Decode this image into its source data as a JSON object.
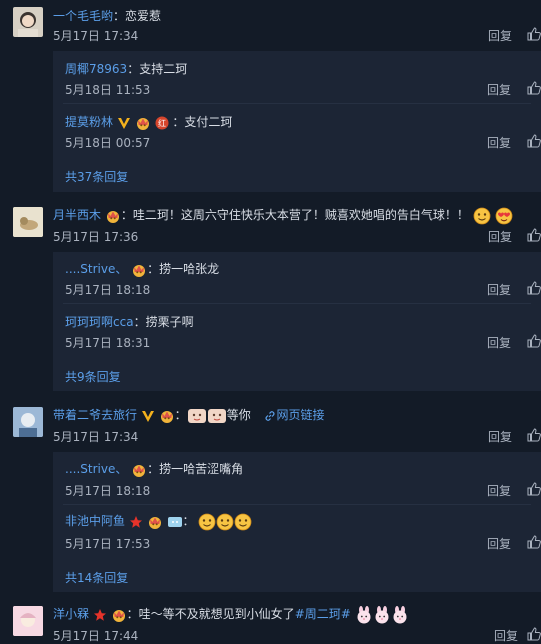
{
  "comments": [
    {
      "user": "一个毛毛哟",
      "text": "：恋爱惹",
      "time": "5月17日 17:34",
      "reply_label": "回复",
      "replies": [
        {
          "user": "周椰78963",
          "text": "：支持二珂",
          "time": "5月18日 11:53",
          "reply_label": "回复"
        },
        {
          "user": "提莫粉林",
          "text": "：支付二珂",
          "time": "5月18日 00:57",
          "reply_label": "回复"
        }
      ],
      "more": "共37条回复"
    },
    {
      "user": "月半西木",
      "text": "：哇二珂！这周六守住快乐大本营了！贼喜欢她唱的告白气球！！",
      "time": "5月17日 17:36",
      "reply_label": "回复",
      "replies": [
        {
          "user": "....Strive、",
          "text": "：捞一哈张龙",
          "time": "5月17日 18:18",
          "reply_label": "回复"
        },
        {
          "user": "珂珂珂啊cca",
          "text": "：捞栗子啊",
          "time": "5月17日 18:31",
          "reply_label": "回复"
        }
      ],
      "more": "共9条回复"
    },
    {
      "user": "带着二爷去旅行",
      "text": "等你",
      "link": "网页链接",
      "time": "5月17日 17:34",
      "reply_label": "回复",
      "replies": [
        {
          "user": "....Strive、",
          "text": "：捞一哈苦涩嘴角",
          "time": "5月17日 18:18",
          "reply_label": "回复"
        },
        {
          "user": "非池中阿鱼",
          "text": "：",
          "time": "5月17日 17:53",
          "reply_label": "回复"
        }
      ],
      "more": "共14条回复"
    },
    {
      "user": "洋小槑",
      "text": "：哇～等不及就想见到小仙女了",
      "hashtag": "#周二珂#",
      "time": "5月17日 17:44",
      "reply_label": "回复"
    }
  ],
  "colors": {
    "background": "#131b27",
    "panel": "#1c2535",
    "link": "#5b9ee8"
  }
}
